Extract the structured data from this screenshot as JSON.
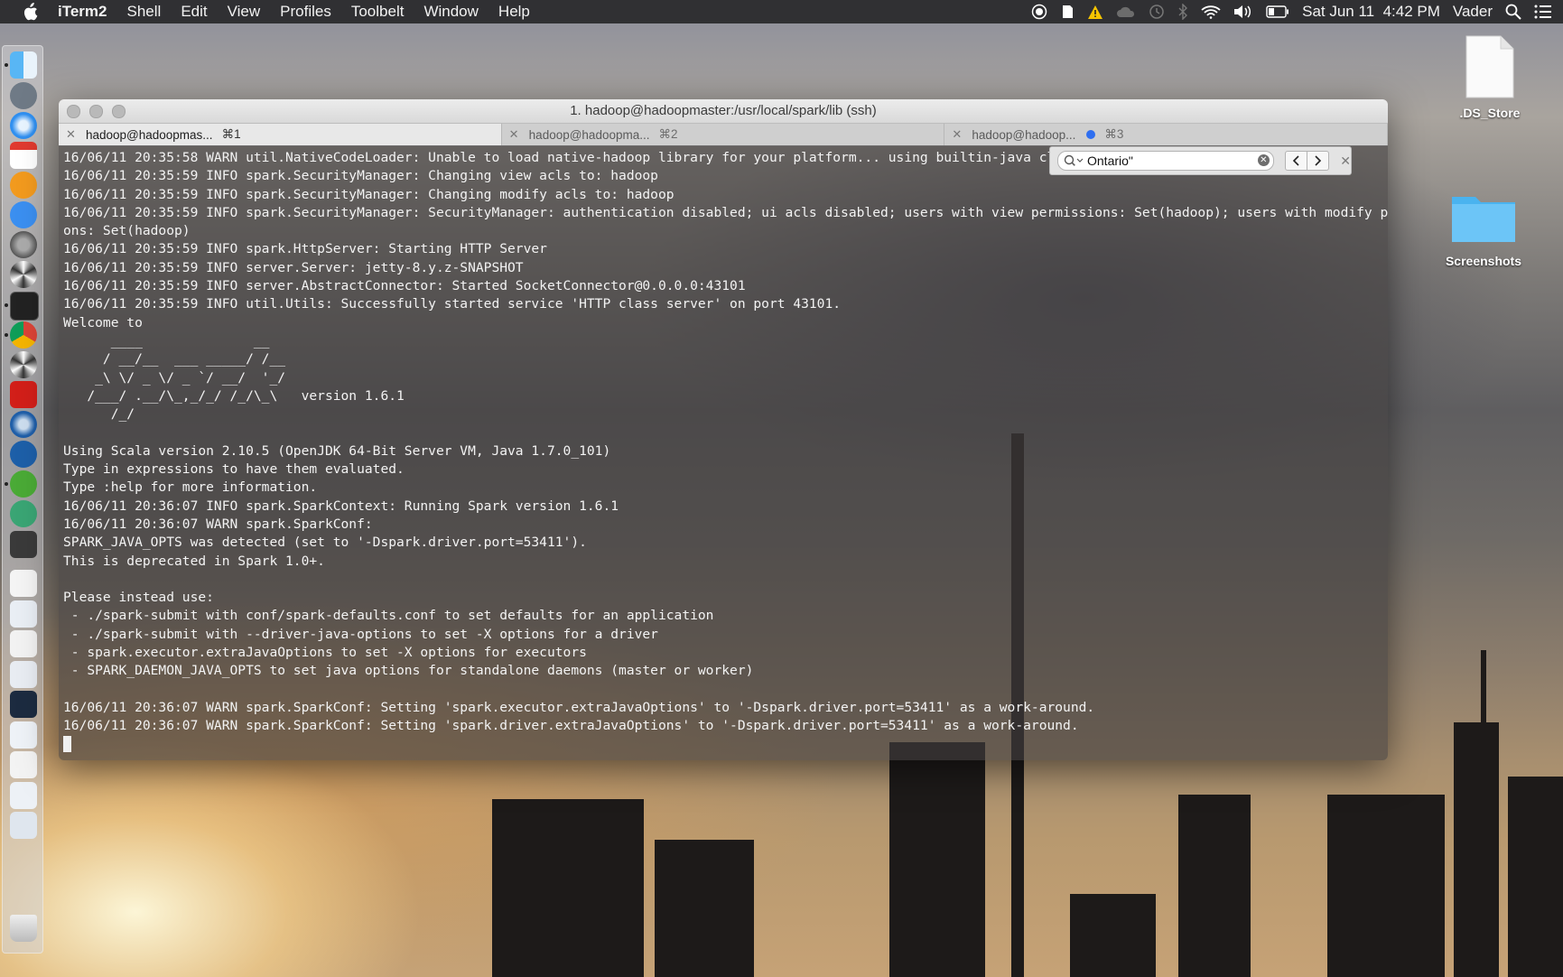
{
  "menubar": {
    "app_name": "iTerm2",
    "items": [
      "Shell",
      "Edit",
      "View",
      "Profiles",
      "Toolbelt",
      "Window",
      "Help"
    ],
    "status": {
      "datetime": "Sat Jun 11  4:42 PM",
      "user": "Vader"
    }
  },
  "desktop": {
    "icons": [
      {
        "label": ".DS_Store"
      },
      {
        "label": "Screenshots"
      }
    ]
  },
  "window": {
    "title": "1. hadoop@hadoopmaster:/usr/local/spark/lib (ssh)",
    "tabs": [
      {
        "label": "hadoop@hadoopmas...",
        "shortcut": "⌘1"
      },
      {
        "label": "hadoop@hadoopma...",
        "shortcut": "⌘2"
      },
      {
        "label": "hadoop@hadoop...",
        "shortcut": "⌘3"
      }
    ],
    "find": {
      "value": "Ontario\""
    },
    "lines": [
      "16/06/11 20:35:58 WARN util.NativeCodeLoader: Unable to load native-hadoop library for your platform... using builtin-java classes",
      "16/06/11 20:35:59 INFO spark.SecurityManager: Changing view acls to: hadoop",
      "16/06/11 20:35:59 INFO spark.SecurityManager: Changing modify acls to: hadoop",
      "16/06/11 20:35:59 INFO spark.SecurityManager: SecurityManager: authentication disabled; ui acls disabled; users with view permissions: Set(hadoop); users with modify permissi",
      "ons: Set(hadoop)",
      "16/06/11 20:35:59 INFO spark.HttpServer: Starting HTTP Server",
      "16/06/11 20:35:59 INFO server.Server: jetty-8.y.z-SNAPSHOT",
      "16/06/11 20:35:59 INFO server.AbstractConnector: Started SocketConnector@0.0.0.0:43101",
      "16/06/11 20:35:59 INFO util.Utils: Successfully started service 'HTTP class server' on port 43101.",
      "Welcome to",
      "      ____              __",
      "     / __/__  ___ _____/ /__",
      "    _\\ \\/ _ \\/ _ `/ __/  '_/",
      "   /___/ .__/\\_,_/_/ /_/\\_\\   version 1.6.1",
      "      /_/",
      "",
      "Using Scala version 2.10.5 (OpenJDK 64-Bit Server VM, Java 1.7.0_101)",
      "Type in expressions to have them evaluated.",
      "Type :help for more information.",
      "16/06/11 20:36:07 INFO spark.SparkContext: Running Spark version 1.6.1",
      "16/06/11 20:36:07 WARN spark.SparkConf:",
      "SPARK_JAVA_OPTS was detected (set to '-Dspark.driver.port=53411').",
      "This is deprecated in Spark 1.0+.",
      "",
      "Please instead use:",
      " - ./spark-submit with conf/spark-defaults.conf to set defaults for an application",
      " - ./spark-submit with --driver-java-options to set -X options for a driver",
      " - spark.executor.extraJavaOptions to set -X options for executors",
      " - SPARK_DAEMON_JAVA_OPTS to set java options for standalone daemons (master or worker)",
      "",
      "16/06/11 20:36:07 WARN spark.SparkConf: Setting 'spark.executor.extraJavaOptions' to '-Dspark.driver.port=53411' as a work-around.",
      "16/06/11 20:36:07 WARN spark.SparkConf: Setting 'spark.driver.extraJavaOptions' to '-Dspark.driver.port=53411' as a work-around."
    ]
  },
  "dock": {
    "icons": [
      "finder-icon",
      "launchpad-icon",
      "safari-icon",
      "calendar-icon",
      "ibooks-icon",
      "app-store-icon",
      "system-preferences-icon",
      "pinwheel-app-icon",
      "terminal-icon",
      "chrome-icon",
      "pinwheel-app-2-icon",
      "acrobat-icon",
      "quicktime-icon",
      "sourcetree-icon",
      "evernote-icon",
      "atom-icon",
      "sublime-text-icon",
      "document-icon",
      "document-2-icon",
      "document-3-icon",
      "document-4-icon",
      "document-5-icon",
      "document-6-icon",
      "document-7-icon",
      "document-8-icon",
      "document-9-icon",
      "trash-icon"
    ]
  }
}
